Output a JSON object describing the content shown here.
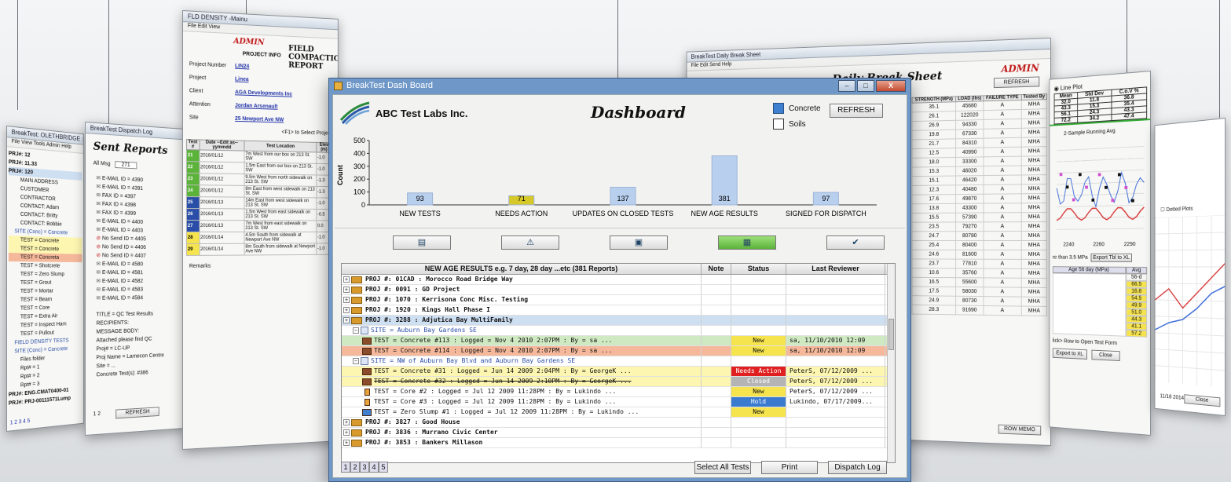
{
  "main": {
    "window_title": "BreakTest Dash Board",
    "window_buttons": [
      "–",
      "□",
      "X"
    ],
    "company": "ABC Test Labs Inc.",
    "title": "Dashboard",
    "filters": {
      "concrete": "Concrete",
      "soils": "Soils",
      "concrete_checked": true,
      "soils_checked": false
    },
    "refresh": "REFRESH",
    "action_icons": [
      "clipboard-icon",
      "warning-icon",
      "document-icon",
      "page-icon",
      "send-icon"
    ],
    "action_glyphs": [
      "▤",
      "⚠",
      "▣",
      "▦",
      "✔"
    ],
    "grid": {
      "headers": [
        "NEW AGE RESULTS e.g. 7 day, 28 day ...etc  (381 Reports)",
        "Note",
        "Status",
        "Last Reviewer"
      ],
      "rows": [
        {
          "kind": "proj",
          "text": "PROJ #: 01CAD      : Morocco Road Bridge Way",
          "status": "",
          "rev": ""
        },
        {
          "kind": "proj",
          "text": "PROJ #: 0091       : GD Project",
          "status": "",
          "rev": ""
        },
        {
          "kind": "proj",
          "text": "PROJ #: 1070       : Kerrisona Conc Misc. Testing",
          "status": "",
          "rev": ""
        },
        {
          "kind": "proj",
          "text": "PROJ #: 1920       : Kings Hall Phase I",
          "status": "",
          "rev": ""
        },
        {
          "kind": "proj-sel",
          "text": "PROJ #: 3288       : Adjutica Bay MultiFamily",
          "status": "",
          "rev": ""
        },
        {
          "kind": "site",
          "text": "SITE  = Auburn Bay Gardens SE",
          "status": "",
          "rev": ""
        },
        {
          "kind": "test-green",
          "text": "TEST = Concrete     #113     : Logged = Nov  4 2010  2:07PM :     By = sa         ...",
          "status": "New",
          "rev": "sa, 11/10/2010 12:09"
        },
        {
          "kind": "test-salmon",
          "text": "TEST = Concrete     #114     : Logged = Nov  4 2010  2:07PM :     By = sa         ...",
          "status": "New",
          "rev": "sa, 11/10/2010 12:09"
        },
        {
          "kind": "site",
          "text": "SITE  = NW of Auburn Bay Blvd and Auburn Bay Gardens SE",
          "status": "",
          "rev": ""
        },
        {
          "kind": "test-yellow",
          "text": "TEST = Concrete     #31      : Logged = Jun 14 2009  2:04PM :     By = GeorgeK    ...",
          "status": "Needs Action",
          "rev": "PeterS, 07/12/2009 ..."
        },
        {
          "kind": "test-yellow-strike",
          "text": "TEST = Concrete     #32      : Logged = Jun 14 2009  2:10PM :     By = GeorgeK    ...",
          "status": "Closed",
          "rev": "PeterS, 07/12/2009 ..."
        },
        {
          "kind": "test-core",
          "text": "TEST = Core         #2       : Logged = Jul 12 2009 11:28PM :     By = Lukindo    ...",
          "status": "New",
          "rev": "PeterS, 07/12/2009 ..."
        },
        {
          "kind": "test-core",
          "text": "TEST = Core         #3       : Logged = Jul 12 2009 11:28PM :     By = Lukindo    ...",
          "status": "Hold",
          "rev": "Lukindo, 07/17/2009..."
        },
        {
          "kind": "test-slump",
          "text": "TEST = Zero Slump   #1       : Logged = Jul 12 2009 11:28PM :     By = Lukindo    ...",
          "status": "New",
          "rev": ""
        },
        {
          "kind": "proj",
          "text": "PROJ #: 3827       : Good House",
          "status": "",
          "rev": ""
        },
        {
          "kind": "proj",
          "text": "PROJ #: 3836       : Murrano Civic Center",
          "status": "",
          "rev": ""
        },
        {
          "kind": "proj",
          "text": "PROJ #: 3853       : Bankers Millason",
          "status": "",
          "rev": ""
        }
      ]
    },
    "pages": [
      "1",
      "2",
      "3",
      "4",
      "5"
    ],
    "footer_buttons": [
      "Select All Tests",
      "Print",
      "Dispatch Log"
    ]
  },
  "chart_data": {
    "type": "bar",
    "categories": [
      "NEW TESTS",
      "NEEDS ACTION",
      "UPDATES ON CLOSED TESTS",
      "NEW AGE RESULTS",
      "SIGNED FOR DISPATCH"
    ],
    "values": [
      93,
      71,
      137,
      381,
      97
    ],
    "colors": [
      "#b9cfee",
      "#d7c829",
      "#b9cfee",
      "#b9cfee",
      "#b9cfee"
    ],
    "ylabel": "Count",
    "ylim": [
      0,
      500
    ],
    "yticks": [
      0,
      100,
      200,
      300,
      400,
      500
    ]
  },
  "bg": {
    "left_window": {
      "title": "BreakTest: OLETHBRIDGE : D",
      "menu": "File  View  Tools  Admin  Help",
      "lines": [
        "PRJ#: 12",
        "PRJ#: 11.33",
        "PRJ#: 120",
        "MAIN ADDRESS",
        "CUSTOMER",
        "CONTRACTOR",
        "CONTACT: Adam",
        "CONTACT: Britty",
        "CONTACT: Bobbie",
        "SITE (Conc) = Concrete",
        "TEST = Concrete",
        "TEST = Concrete",
        "TEST = Concreta",
        "TEST = Shotcrete",
        "TEST = Zero Slump",
        "TEST = Grout",
        "TEST = Mortar",
        "TEST = Beam",
        "TEST = Core",
        "TEST = Extra Air",
        "TEST = Inspect Ham",
        "TEST = Pullout",
        "FIELD DENSITY TESTS",
        "SITE (Conc) = Concrete",
        "Files folder",
        "Rpt# = 1",
        "Rpt# = 2",
        "Rpt# = 3",
        "PRJ#: ENG.CMAT0400-01",
        "PRJ#: PRJ-00111571Lump"
      ],
      "pages": "1 2 3 4 5"
    },
    "dispatch_window": {
      "title": "BreakTest Dispatch Log",
      "heading": "Sent Reports",
      "all_msg": "All Msg",
      "all_msg_value": "271",
      "items": [
        "E-MAIL  ID = 4390",
        "E-MAIL  ID = 4391",
        "FAX     ID = 4397",
        "FAX     ID = 4398",
        "FAX     ID = 4399",
        "E-MAIL  ID = 4400",
        "E-MAIL  ID = 4403",
        "No Send ID = 4405",
        "No Send ID = 4406",
        "No Send ID = 4407",
        "E-MAIL  ID = 4580",
        "E-MAIL  ID = 4581",
        "E-MAIL  ID = 4582",
        "E-MAIL  ID = 4583",
        "E-MAIL  ID = 4584"
      ],
      "detail": [
        "TITLE = QC Test Results",
        "RECIPIENTS:",
        "MESSAGE BODY:",
        "Attached please find QC",
        "Proj# = LC-UP",
        "Proj Name = Lamecon Centre",
        "Site = ...",
        "Concrete  Test(s): #386"
      ],
      "refresh": "REFRESH",
      "pages": "1 2"
    },
    "fld_window": {
      "title": "FLD DENSITY -Mainu",
      "menu": "File  Edit  View",
      "admin": "ADMIN",
      "heading": "FIELD COMPACTION REPORT",
      "project_info": "PROJECT INFO",
      "fields": [
        "Project Number",
        "Project",
        "Client",
        "Attention",
        "Site"
      ],
      "values": [
        "LIN24",
        "Linea",
        "AGA Developments Inc",
        "Jordan Arsenault",
        "25 Newport Ave NW"
      ],
      "hint": "<F1> to Select Project",
      "col_headers": [
        "Test #",
        "Date --Edit as-- yymmdd",
        "Test Location",
        "Elev (m)"
      ],
      "rows": [
        [
          "21",
          "2016/01/12",
          "7m West from our box on 213 St. SW",
          "-1.0"
        ],
        [
          "22",
          "2016/01/12",
          "1.5m East from our box on 213 St. SW",
          "-1.0"
        ],
        [
          "23",
          "2016/01/12",
          "9.5m West from north sidewalk on 213 St. SW",
          "-1.3"
        ],
        [
          "24",
          "2016/01/12",
          "8m East from west sidewalk on 213 St. SW",
          "-1.3"
        ],
        [
          "25",
          "2016/01/13",
          "14m East from west sidewalk on 213 St. SW",
          "-1.0"
        ],
        [
          "26",
          "2016/01/13",
          "1.5m West from east sidewalk on 213 St. SW",
          "-0.5"
        ],
        [
          "27",
          "2016/01/13",
          "7m West from east sidewalk on 213 St. SW",
          "0.0"
        ],
        [
          "28",
          "2016/01/14",
          "4.5m South from sidewalk at Newport Ave NW",
          "-1.0"
        ],
        [
          "29",
          "2016/01/14",
          "8m South from sidewalk at Newport Ave NW",
          "-1.0"
        ]
      ],
      "remarks": "Remarks"
    },
    "daily_window": {
      "title": "BreakTest Daily Break Sheet",
      "menu": "File  Edit  Send  Help",
      "heading": "Daily Break Sheet",
      "admin": "ADMIN",
      "refresh": "REFRESH",
      "headers": [
        "STRENGTH (MPa)",
        "LOAD (lbs)",
        "FAILURE TYPE",
        "Tested By"
      ],
      "rows": [
        [
          "35.1",
          "45680",
          "A",
          "MHA"
        ],
        [
          "26.1",
          "122020",
          "A",
          "MHA"
        ],
        [
          "26.9",
          "94330",
          "A",
          "MHA"
        ],
        [
          "19.8",
          "67330",
          "A",
          "MHA"
        ],
        [
          "21.7",
          "84310",
          "A",
          "MHA"
        ],
        [
          "12.5",
          "40990",
          "A",
          "MHA"
        ],
        [
          "18.0",
          "33300",
          "A",
          "MHA"
        ],
        [
          "15.3",
          "46020",
          "A",
          "MHA"
        ],
        [
          "15.1",
          "46420",
          "A",
          "MHA"
        ],
        [
          "12.3",
          "40480",
          "A",
          "MHA"
        ],
        [
          "17.6",
          "49870",
          "A",
          "MHA"
        ],
        [
          "13.8",
          "43300",
          "A",
          "MHA"
        ],
        [
          "15.5",
          "57390",
          "A",
          "MHA"
        ],
        [
          "23.5",
          "79270",
          "A",
          "MHA"
        ],
        [
          "24.7",
          "80780",
          "A",
          "MHA"
        ],
        [
          "25.4",
          "80400",
          "A",
          "MHA"
        ],
        [
          "24.6",
          "81600",
          "A",
          "MHA"
        ],
        [
          "23.7",
          "77810",
          "A",
          "MHA"
        ],
        [
          "10.6",
          "35760",
          "A",
          "MHA"
        ],
        [
          "16.5",
          "55600",
          "A",
          "MHA"
        ],
        [
          "17.5",
          "58030",
          "A",
          "MHA"
        ],
        [
          "24.9",
          "80730",
          "A",
          "MHA"
        ],
        [
          "28.3",
          "91690",
          "A",
          "MHA"
        ]
      ],
      "row_memo": "ROW MEMO"
    },
    "stats_window": {
      "line_plot": "Line Plot",
      "headers": [
        "Mean",
        "Std Dev",
        "C.o.V %"
      ],
      "rows": [
        [
          "32.0",
          "11.8",
          "36.8"
        ],
        [
          "43.3",
          "15.3",
          "35.4"
        ],
        [
          "56.1",
          "24.3",
          "43.3"
        ],
        [
          "72.2",
          "34.2",
          "47.4"
        ]
      ],
      "running_avg": "2-Sample Running Avg",
      "x_ticks": [
        "2240",
        "2260",
        "2290"
      ],
      "than": "re than 3.5 MPa",
      "export_tbl": "Export Tbl to XL",
      "age_hdr": "Age 56 day (MPa)",
      "avg_hdr": "Avg",
      "avg_sub": "56-d",
      "avg_values": [
        "66.5",
        "16.8",
        "54.5",
        "49.9",
        "51.0",
        "44.3",
        "41.1",
        "57.2"
      ],
      "click_hint": "lick> Row to Open Test Form",
      "export_xl": "Export to XL",
      "close": "Close"
    },
    "right_window": {
      "dotted": "Dotted Plots",
      "dates": [
        "11/18 2014",
        "01/18 2015"
      ],
      "close": "Close"
    }
  }
}
